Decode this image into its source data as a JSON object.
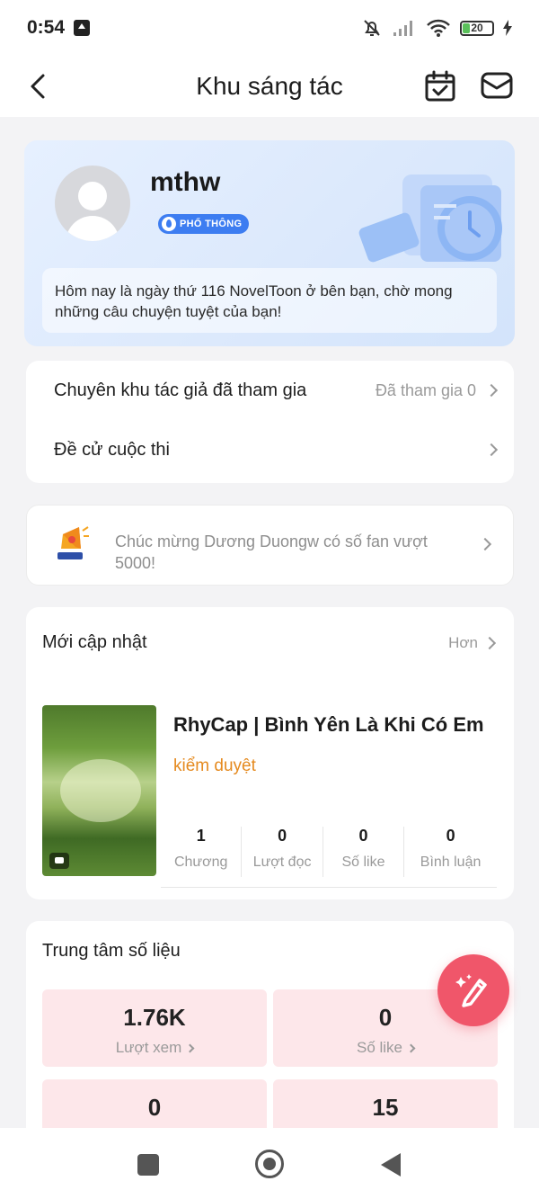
{
  "status_bar": {
    "time": "0:54",
    "battery": "20"
  },
  "nav": {
    "title": "Khu sáng tác"
  },
  "profile": {
    "username": "mthw",
    "level_badge": "PHỔ THÔNG",
    "greeting": "Hôm nay là ngày thứ 116 NovelToon ở bên bạn, chờ mong những câu chuyện tuyệt của bạn!"
  },
  "menu": {
    "items": [
      {
        "label": "Chuyên khu tác giả đã tham gia",
        "value": "Đã tham gia 0"
      },
      {
        "label": "Đề cử cuộc thi",
        "value": ""
      }
    ]
  },
  "notice": {
    "text": "Chúc mừng Dương Duongw có số fan vượt 5000!"
  },
  "updates": {
    "title": "Mới cập nhật",
    "more": "Hơn",
    "book": {
      "title": "RhyCap | Bình Yên Là Khi Có Em",
      "status": "kiểm duyệt",
      "stats": [
        {
          "value": "1",
          "label": "Chương"
        },
        {
          "value": "0",
          "label": "Lượt đọc"
        },
        {
          "value": "0",
          "label": "Số like"
        },
        {
          "value": "0",
          "label": "Bình luận"
        }
      ]
    }
  },
  "data_center": {
    "title": "Trung tâm số liệu",
    "tiles": [
      {
        "value": "1.76K",
        "label": "Lượt xem"
      },
      {
        "value": "0",
        "label": "Số like"
      },
      {
        "value": "0",
        "label": ""
      },
      {
        "value": "15",
        "label": ""
      }
    ]
  },
  "colors": {
    "accent_pink": "#f0566a",
    "status_orange": "#e58a1f",
    "badge_blue": "#3d7df1",
    "tile_bg": "#fde7ea"
  },
  "icons": {
    "back": "chevron-left-icon",
    "calendar": "calendar-check-icon",
    "mail": "mail-icon",
    "megaphone": "megaphone-icon",
    "edit": "pencil-sparkle-icon"
  }
}
